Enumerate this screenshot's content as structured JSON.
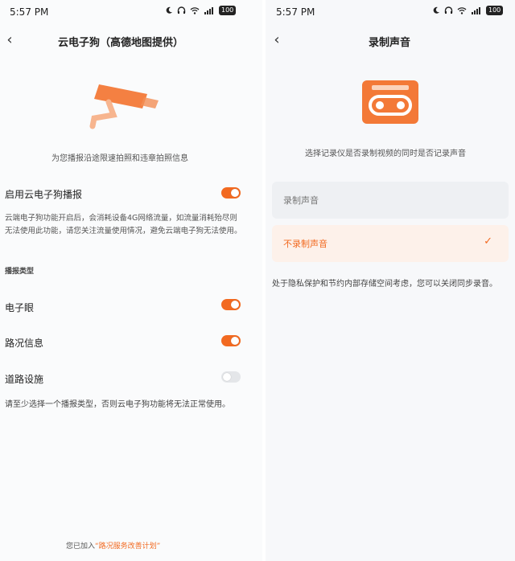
{
  "status_bar": {
    "time": "5:57 PM",
    "battery": "100"
  },
  "left": {
    "back_icon": "chevron-left-icon",
    "title": "云电子狗（高德地图提供）",
    "caption": "为您播报沿途限速拍照和违章拍照信息",
    "enable_label": "启用云电子狗播报",
    "description": "云端电子狗功能开启后，会消耗设备4G网络流量，如流量消耗殆尽则无法使用此功能，请您关注流量使用情况，避免云端电子狗无法使用。",
    "section_title": "播报类型",
    "items": [
      {
        "label": "电子眼",
        "enabled": true
      },
      {
        "label": "路况信息",
        "enabled": true
      },
      {
        "label": "道路设施",
        "enabled": false
      }
    ],
    "warning": "请至少选择一个播报类型，否则云电子狗功能将无法正常使用。",
    "footer_prefix": "您已加入",
    "footer_link": "“路况服务改善计划”",
    "colors": {
      "accent": "#f26a21"
    }
  },
  "right": {
    "back_icon": "chevron-left-icon",
    "title": "录制声音",
    "caption": "选择记录仪是否录制视频的同时是否记录声音",
    "options": [
      {
        "label": "录制声音",
        "selected": false
      },
      {
        "label": "不录制声音",
        "selected": true
      }
    ],
    "check_icon": "checkmark-icon",
    "note": "处于隐私保护和节约内部存储空间考虑，您可以关闭同步录音。"
  }
}
